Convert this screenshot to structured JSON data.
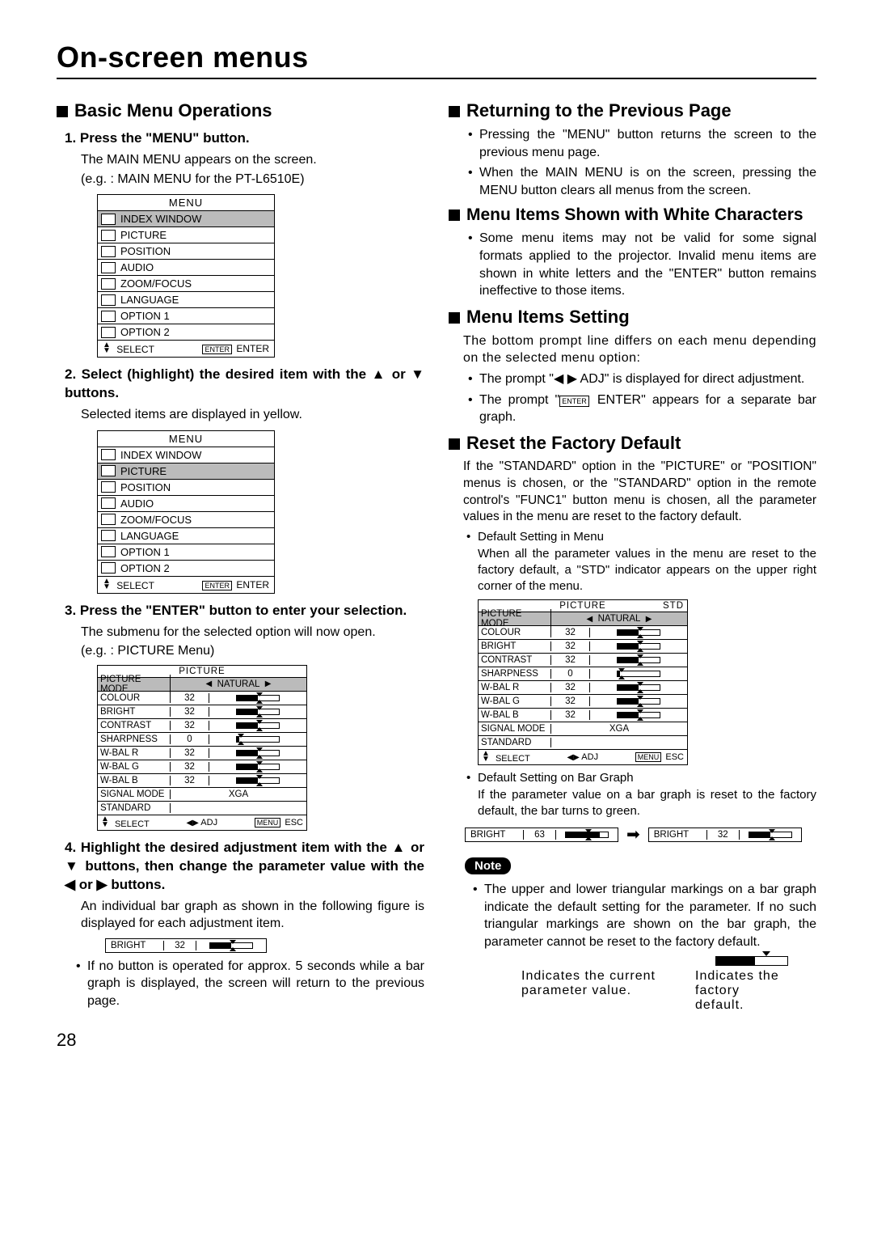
{
  "page_title": "On-screen menus",
  "page_number": "28",
  "left": {
    "h_basic": "Basic Menu Operations",
    "s1_title": "1. Press the \"MENU\" button.",
    "s1_body1": "The MAIN MENU appears on the screen.",
    "s1_body2": "(e.g. : MAIN MENU for the PT-L6510E)",
    "menu1": {
      "title": "MENU",
      "items": [
        "INDEX WINDOW",
        "PICTURE",
        "POSITION",
        "AUDIO",
        "ZOOM/FOCUS",
        "LANGUAGE",
        "OPTION 1",
        "OPTION 2"
      ],
      "highlight_index": 0,
      "foot_select": "SELECT",
      "foot_enter": "ENTER"
    },
    "s2_title": "2. Select (highlight) the desired item with the ▲ or ▼ buttons.",
    "s2_body": "Selected items are displayed in yellow.",
    "menu2": {
      "title": "MENU",
      "items": [
        "INDEX WINDOW",
        "PICTURE",
        "POSITION",
        "AUDIO",
        "ZOOM/FOCUS",
        "LANGUAGE",
        "OPTION 1",
        "OPTION 2"
      ],
      "highlight_index": 1,
      "foot_select": "SELECT",
      "foot_enter": "ENTER"
    },
    "s3_title": "3. Press the \"ENTER\" button to enter your selection.",
    "s3_body1": "The submenu for the selected option will now open.",
    "s3_body2": "(e.g. :  PICTURE Menu)",
    "picture_table": {
      "title": "PICTURE",
      "std": "",
      "rows": [
        {
          "name": "PICTURE MODE",
          "val": "NATURAL",
          "type": "select",
          "hl": true
        },
        {
          "name": "COLOUR",
          "val": "32",
          "type": "bar",
          "fill": 50
        },
        {
          "name": "BRIGHT",
          "val": "32",
          "type": "bar",
          "fill": 50
        },
        {
          "name": "CONTRAST",
          "val": "32",
          "type": "bar",
          "fill": 50
        },
        {
          "name": "SHARPNESS",
          "val": "0",
          "type": "bar",
          "fill": 5
        },
        {
          "name": "W-BAL R",
          "val": "32",
          "type": "bar",
          "fill": 50
        },
        {
          "name": "W-BAL G",
          "val": "32",
          "type": "bar",
          "fill": 50
        },
        {
          "name": "W-BAL B",
          "val": "32",
          "type": "bar",
          "fill": 50
        },
        {
          "name": "SIGNAL MODE",
          "val": "XGA",
          "type": "text"
        },
        {
          "name": "STANDARD",
          "val": "",
          "type": "blank"
        }
      ],
      "foot_select": "SELECT",
      "foot_adj": "ADJ",
      "foot_esc": "ESC"
    },
    "s4_title": "4. Highlight the desired adjustment item with the ▲ or ▼ buttons, then change the parameter value with the ◀ or ▶ buttons.",
    "s4_body": "An individual bar graph as shown in the following figure is displayed for each adjustment item.",
    "bar_single": {
      "name": "BRIGHT",
      "val": "32",
      "fill": 50
    },
    "s4_bullet": "If no button is operated for approx. 5 seconds while a bar graph is displayed, the screen will return to the previous page."
  },
  "right": {
    "h_return": "Returning to the Previous Page",
    "return_b1": "Pressing the \"MENU\" button returns the screen to the previous menu page.",
    "return_b2": "When the MAIN MENU is on the screen, pressing the MENU button clears all menus from the screen.",
    "h_white": "Menu Items Shown with White Characters",
    "white_b1": "Some menu items may not be valid for some signal formats applied to the projector. Invalid menu items are shown in white letters and the \"ENTER\" button remains ineffective to those items.",
    "h_setting": "Menu Items Setting",
    "setting_body": "The bottom prompt line differs on each menu depending on the selected menu option:",
    "setting_b1": "The prompt \"◀ ▶  ADJ\" is displayed for direct adjustment.",
    "setting_b2a": "The prompt \"",
    "setting_b2b": " ENTER\" appears for a separate bar graph.",
    "enter_label": "ENTER",
    "h_reset": "Reset the Factory Default",
    "reset_body": "If the \"STANDARD\" option in the \"PICTURE\" or \"POSITION\" menus is chosen, or the \"STANDARD\" option in the remote control's \"FUNC1\" button menu is chosen, all the parameter values in the menu are reset to the factory default.",
    "reset_b1_title": "Default Setting in Menu",
    "reset_b1_body": "When all the parameter values in the menu are reset to the factory default, a \"STD\" indicator appears on the upper right corner of the menu.",
    "picture_table2": {
      "title": "PICTURE",
      "std": "STD",
      "rows": [
        {
          "name": "PICTURE MODE",
          "val": "NATURAL",
          "type": "select",
          "hl": true
        },
        {
          "name": "COLOUR",
          "val": "32",
          "type": "bar",
          "fill": 50
        },
        {
          "name": "BRIGHT",
          "val": "32",
          "type": "bar",
          "fill": 50
        },
        {
          "name": "CONTRAST",
          "val": "32",
          "type": "bar",
          "fill": 50
        },
        {
          "name": "SHARPNESS",
          "val": "0",
          "type": "bar",
          "fill": 5
        },
        {
          "name": "W-BAL R",
          "val": "32",
          "type": "bar",
          "fill": 50
        },
        {
          "name": "W-BAL G",
          "val": "32",
          "type": "bar",
          "fill": 50
        },
        {
          "name": "W-BAL B",
          "val": "32",
          "type": "bar",
          "fill": 50
        },
        {
          "name": "SIGNAL MODE",
          "val": "XGA",
          "type": "text"
        },
        {
          "name": "STANDARD",
          "val": "",
          "type": "blank"
        }
      ],
      "foot_select": "SELECT",
      "foot_adj": "ADJ",
      "foot_esc": "ESC"
    },
    "reset_b2_title": "Default Setting on Bar Graph",
    "reset_b2_body": "If the parameter value on a bar graph is reset to the factory default, the bar turns to green.",
    "bar_left": {
      "name": "BRIGHT",
      "val": "63",
      "fill": 80
    },
    "bar_right": {
      "name": "BRIGHT",
      "val": "32",
      "fill": 50
    },
    "note_label": "Note",
    "note_body": "The upper and lower triangular markings on a bar graph indicate the default setting for the parameter. If no such triangular markings are shown on the bar graph, the parameter cannot be reset to the factory default.",
    "diag_left": "Indicates the current parameter value.",
    "diag_right": "Indicates the factory default.",
    "menu_label": "MENU",
    "enter_small": "ENTER"
  }
}
